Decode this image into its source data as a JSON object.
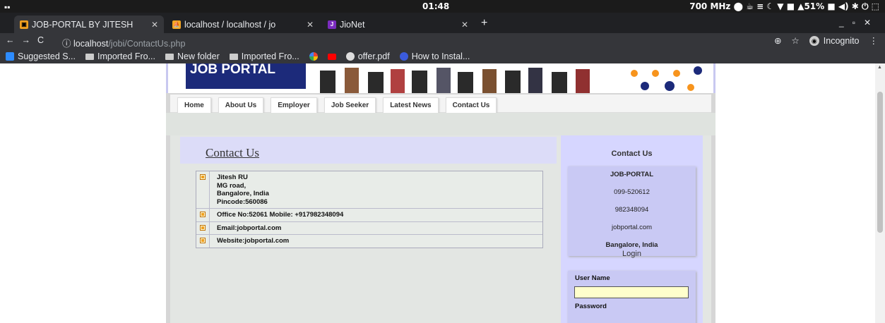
{
  "system": {
    "clock": "01:48",
    "status": "700 MHz  ⬤ ☕ ≡ ☾ ▼ ■ ▲51% ■ ◀) ✱  ⏻ ⬚"
  },
  "browser": {
    "tabs": [
      {
        "title": "JOB-PORTAL BY JITESH",
        "active": true
      },
      {
        "title": "localhost / localhost / jo",
        "active": false
      },
      {
        "title": "JioNet",
        "active": false
      }
    ],
    "url_host": "localhost",
    "url_path": "/jobi/ContactUs.php",
    "incognito_label": "Incognito",
    "bookmarks": [
      "Suggested S...",
      "Imported Fro...",
      "New folder",
      "Imported Fro...",
      "offer.pdf",
      "How to Instal..."
    ]
  },
  "site": {
    "logo": "JOB PORTAL",
    "nav": [
      "Home",
      "About Us",
      "Employer",
      "Job Seeker",
      "Latest News",
      "Contact Us"
    ],
    "heading": "Contact Us",
    "address": [
      "Jitesh RU",
      "MG road,",
      "Bangalore, India",
      "Pincode:560086"
    ],
    "office": "Office No:52061 Mobile: +917982348094",
    "email": "Email:jobportal.com",
    "website": "Website:jobportal.com",
    "sidebar": {
      "contact_title": "Contact Us",
      "company": "JOB-PORTAL",
      "phone1": "099-520612",
      "phone2": "982348094",
      "site": "jobportal.com",
      "city": "Bangalore, India",
      "login_title": "Login",
      "username_label": "User Name",
      "password_label": "Password"
    }
  },
  "colors": {
    "sidebar_bg": "#d6d6ff",
    "logo_bg": "#1c2a7a",
    "bullet": "#f0a020",
    "input_bg": "#ffffcc"
  }
}
